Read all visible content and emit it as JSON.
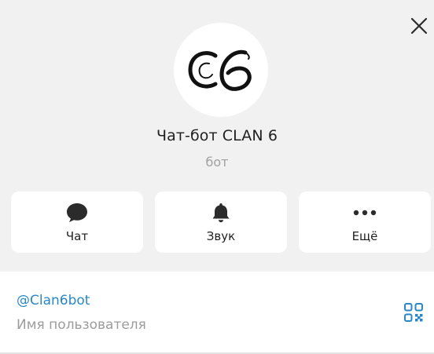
{
  "profile": {
    "name": "Чат-бот CLAN 6",
    "subtitle": "бот",
    "avatar_logo": "CLAN 6 monogram logo"
  },
  "actions": [
    {
      "label": "Чат",
      "icon": "chat-bubble-icon"
    },
    {
      "label": "Звук",
      "icon": "bell-icon"
    },
    {
      "label": "Ещё",
      "icon": "more-dots-icon"
    }
  ],
  "info": {
    "username": "@Clan6bot",
    "username_label": "Имя пользователя",
    "qr_icon": "qr-code-icon"
  },
  "colors": {
    "background": "#f1f1f1",
    "card": "#ffffff",
    "accent": "#2a87c6",
    "text": "#1f1f1f",
    "muted": "#9c9c9c"
  }
}
